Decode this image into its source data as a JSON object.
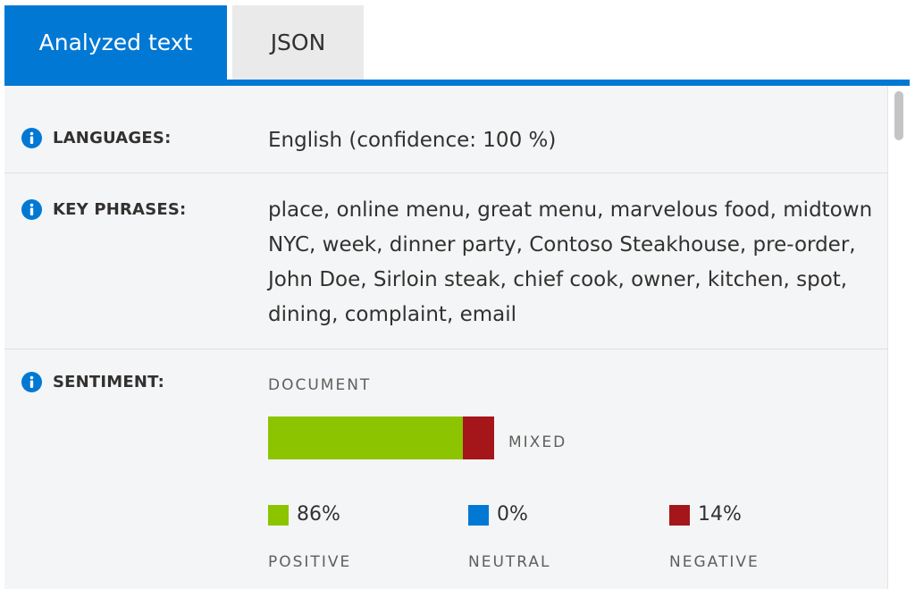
{
  "tabs": [
    {
      "label": "Analyzed text",
      "active": true
    },
    {
      "label": "JSON",
      "active": false
    }
  ],
  "info_icon": "info-icon",
  "rows": {
    "languages": {
      "label": "LANGUAGES:",
      "value": "English (confidence: 100 %)"
    },
    "key_phrases": {
      "label": "KEY PHRASES:",
      "lines": [
        "place, online menu, great menu, marvelous food, midtown",
        "NYC, week, dinner party, Contoso Steakhouse, pre-order,",
        "John Doe, Sirloin steak, chief cook, owner, kitchen, spot,",
        "dining, complaint, email"
      ]
    },
    "sentiment": {
      "label": "SENTIMENT:",
      "document_label": "DOCUMENT",
      "overall": "MIXED",
      "scores": [
        {
          "name": "POSITIVE",
          "percent_text": "86%",
          "value": 0.86,
          "color": "#8cc400"
        },
        {
          "name": "NEUTRAL",
          "percent_text": "0%",
          "value": 0.0,
          "color": "#0078d4"
        },
        {
          "name": "NEGATIVE",
          "percent_text": "14%",
          "value": 0.14,
          "color": "#a4161a"
        }
      ]
    }
  },
  "colors": {
    "accent": "#0078d4",
    "positive": "#8cc400",
    "negative": "#a4161a",
    "neutral": "#0078d4"
  }
}
